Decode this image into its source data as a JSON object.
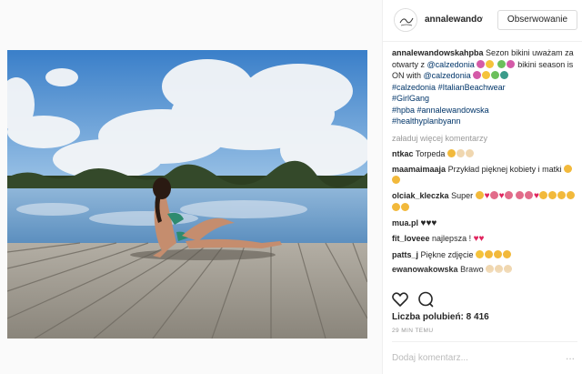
{
  "header": {
    "username": "annalewandow",
    "follow_label": "Obserwowanie"
  },
  "post": {
    "caption_user": "annalewandowskahpba",
    "caption_part1": "Sezon bikini uważam za otwarty z",
    "mention1": "@calzedonia",
    "caption_part2": "bikini season is ON with",
    "mention2": "@calzedonia",
    "hashtags": [
      "#calzedonia",
      "#ItalianBeachwear",
      "#GirlGang",
      "#hpba",
      "#annalewandowska",
      "#healthyplanbyann"
    ],
    "load_more": "załaduj więcej komentarzy"
  },
  "comments": [
    {
      "user": "ntkac",
      "text": "Torpeda"
    },
    {
      "user": "maamaimaaja",
      "text": "Przykład pięknej kobiety i matki"
    },
    {
      "user": "olciak_kleczka",
      "text": "Super"
    },
    {
      "user": "mua.pl",
      "text": ""
    },
    {
      "user": "fit_loveee",
      "text": "najlepsza !"
    },
    {
      "user": "patts_j",
      "text": "Piękne zdjęcie"
    },
    {
      "user": "ewanowakowska",
      "text": "Brawo"
    }
  ],
  "stats": {
    "likes": "Liczba polubień: 8 416",
    "time": "29 MIN TEMU"
  },
  "composer": {
    "placeholder": "Dodaj komentarz...",
    "more": "..."
  },
  "icons": {
    "like": "heart-outline-icon",
    "comment": "speech-bubble-icon"
  },
  "colors": {
    "link": "#003569",
    "muted": "#999999",
    "heart": "#e0245e"
  }
}
